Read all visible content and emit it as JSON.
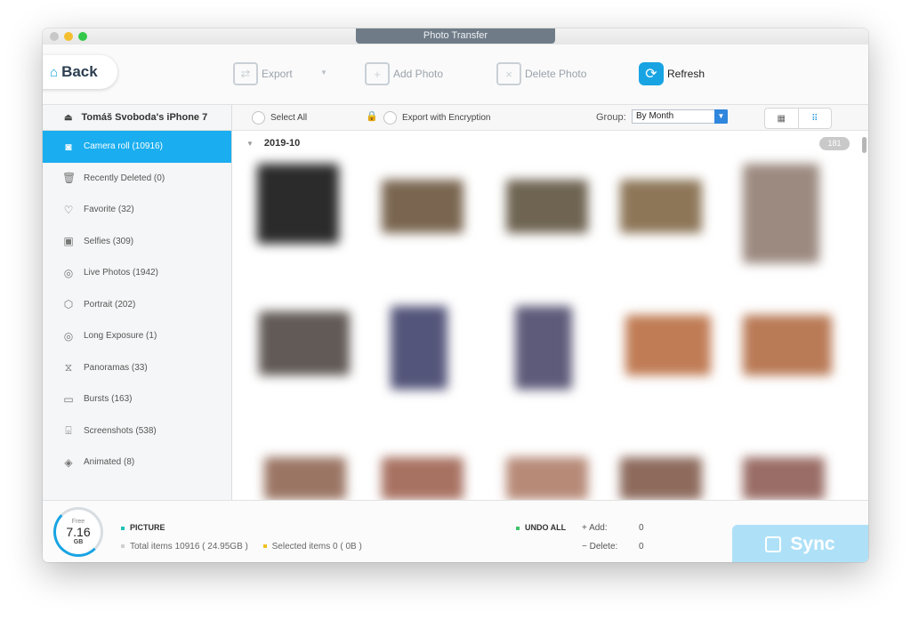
{
  "window": {
    "title": "Photo Transfer"
  },
  "toolbar": {
    "back_label": "Back",
    "export_label": "Export",
    "add_photo_label": "Add Photo",
    "delete_photo_label": "Delete Photo",
    "refresh_label": "Refresh"
  },
  "sidebar": {
    "device_name": "Tomáš Svoboda's iPhone 7",
    "items": [
      {
        "label": "Camera roll (10916)",
        "icon": "camera-icon",
        "active": true
      },
      {
        "label": "Recently Deleted (0)",
        "icon": "trash-icon"
      },
      {
        "label": "Favorite (32)",
        "icon": "heart-icon"
      },
      {
        "label": "Selfies (309)",
        "icon": "portrait-frame-icon"
      },
      {
        "label": "Live Photos (1942)",
        "icon": "live-photo-icon"
      },
      {
        "label": "Portrait (202)",
        "icon": "cube-icon"
      },
      {
        "label": "Long Exposure (1)",
        "icon": "long-exposure-icon"
      },
      {
        "label": "Panoramas (33)",
        "icon": "panorama-icon"
      },
      {
        "label": "Bursts (163)",
        "icon": "bursts-icon"
      },
      {
        "label": "Screenshots (538)",
        "icon": "screenshot-icon"
      },
      {
        "label": "Animated (8)",
        "icon": "animated-icon"
      }
    ]
  },
  "options": {
    "select_all_label": "Select All",
    "export_encryption_label": "Export with Encryption",
    "group_label": "Group:",
    "group_value": "By Month"
  },
  "month": {
    "label": "2019-10",
    "count": "181"
  },
  "footer": {
    "free_label": "Free",
    "free_value": "7.16",
    "free_unit": "GB",
    "picture_label": "PICTURE",
    "total_items": "Total items 10916 ( 24.95GB )",
    "selected_items": "Selected items 0 ( 0B )",
    "undo_all_label": "UNDO ALL",
    "add_label": "+ Add:",
    "add_value": "0",
    "delete_label": "− Delete:",
    "delete_value": "0",
    "sync_label": "Sync"
  },
  "colors": {
    "accent": "#1aaef0",
    "sync": "#aee1f7",
    "picture_dot": "#1fc2b4",
    "selected_dot": "#f0c020",
    "undo_dot": "#3dc46a"
  }
}
